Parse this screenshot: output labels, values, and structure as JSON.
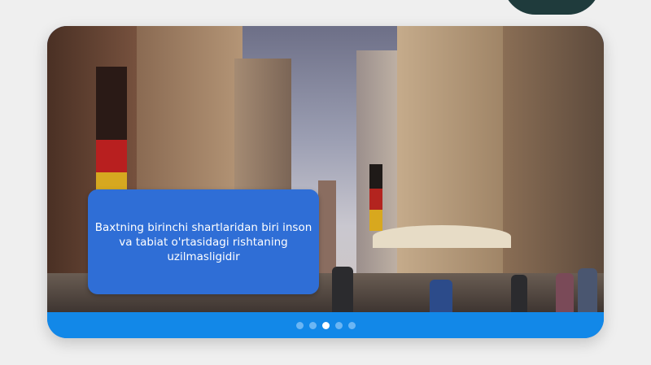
{
  "slider": {
    "caption": "Baxtning birinchi shartlaridan biri inson va tabiat o'rtasidagi rishtaning uzilmasligidir",
    "image": "city street with historic buildings, flags and cathedral tower",
    "dots": [
      {
        "active": false
      },
      {
        "active": false
      },
      {
        "active": true
      },
      {
        "active": false
      },
      {
        "active": false
      }
    ],
    "colors": {
      "bar": "#1288e8",
      "caption_bg": "#2f6ed6",
      "dot": "#6bb6f4",
      "dot_active": "#ffffff"
    }
  }
}
